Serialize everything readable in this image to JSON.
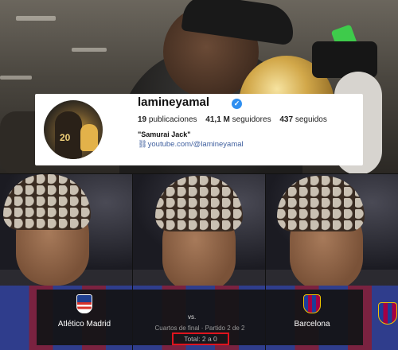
{
  "instagram_profile": {
    "username": "lamineyamal",
    "verified": true,
    "stats": {
      "posts_count": "19",
      "posts_label": "publicaciones",
      "followers_count": "41,1 M",
      "followers_label": "seguidores",
      "following_count": "437",
      "following_label": "seguidos"
    },
    "bio": "\"Samurai Jack\"",
    "link": "youtube.com/@lamineyamal",
    "link_color": "#3f5f9e",
    "verified_color": "#2f8ff0"
  },
  "match": {
    "home_team": "Atlético Madrid",
    "away_team": "Barcelona",
    "vs_text": "vs.",
    "round_text": "Cuartos de final · Partido 2 de 2",
    "total_text": "Total: 2 a 0",
    "highlight_color": "#e0141e"
  },
  "icons": [
    "verified-badge-icon",
    "link-icon",
    "atletico-crest-icon",
    "barcelona-crest-icon"
  ]
}
